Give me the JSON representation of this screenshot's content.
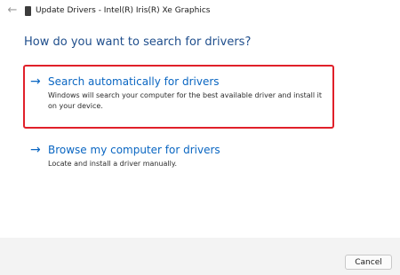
{
  "window": {
    "back_icon": "back-arrow-icon",
    "device_icon": "display-adapter-icon",
    "title": "Update Drivers - Intel(R) Iris(R) Xe Graphics"
  },
  "main": {
    "question": "How do you want to search for drivers?",
    "options": [
      {
        "icon": "right-arrow-icon",
        "title": "Search automatically for drivers",
        "description": "Windows will search your computer for the best available driver and install it on your device.",
        "highlighted": true
      },
      {
        "icon": "right-arrow-icon",
        "title": "Browse my computer for drivers",
        "description": "Locate and install a driver manually.",
        "highlighted": false
      }
    ],
    "highlight_color": "#e0202a",
    "link_color": "#0a66c2"
  },
  "footer": {
    "cancel_label": "Cancel"
  }
}
